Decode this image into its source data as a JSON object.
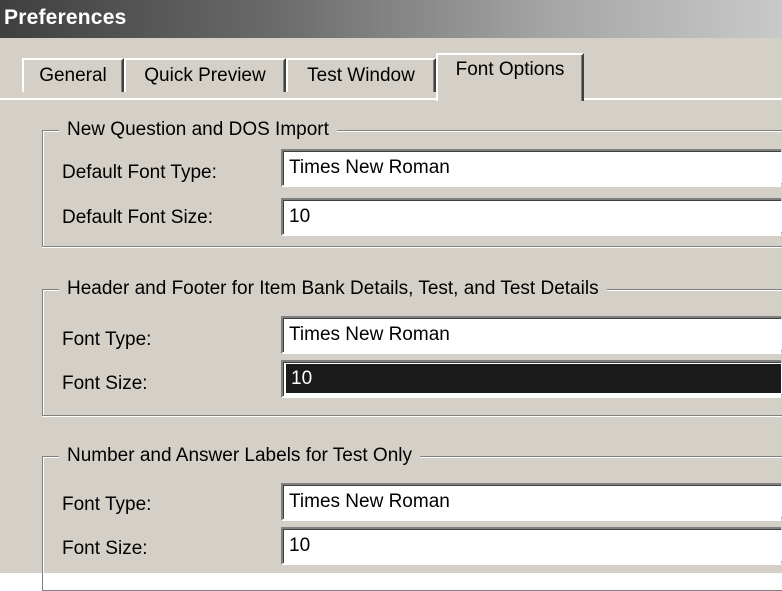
{
  "window": {
    "title": "Preferences"
  },
  "tabs": [
    {
      "label": "General",
      "active": false
    },
    {
      "label": "Quick Preview",
      "active": false
    },
    {
      "label": "Test Window",
      "active": false
    },
    {
      "label": "Font Options",
      "active": true
    }
  ],
  "groups": [
    {
      "title": "New Question and DOS Import",
      "fields": [
        {
          "label": "Default Font Type:",
          "value": "Times New Roman"
        },
        {
          "label": "Default Font Size:",
          "value": "10"
        }
      ]
    },
    {
      "title": "Header and Footer for Item Bank Details, Test, and Test Details",
      "fields": [
        {
          "label": "Font Type:",
          "value": "Times New Roman"
        },
        {
          "label": "Font Size:",
          "value": "10",
          "selected": true
        }
      ]
    },
    {
      "title": "Number and Answer Labels for Test Only",
      "fields": [
        {
          "label": "Font Type:",
          "value": "Times New Roman"
        },
        {
          "label": "Font Size:",
          "value": "10"
        }
      ]
    }
  ],
  "icons": {
    "dropdown": "chevron-down-icon"
  }
}
